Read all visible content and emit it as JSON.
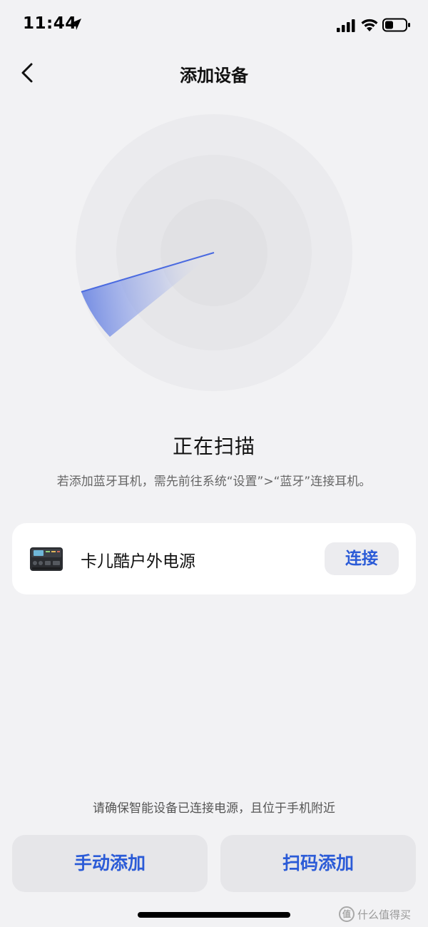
{
  "status_bar": {
    "time": "11:44",
    "icons": [
      "location-arrow-icon",
      "cellular-signal-icon",
      "wifi-icon",
      "battery-icon"
    ]
  },
  "nav": {
    "back_icon": "chevron-left-icon",
    "title": "添加设备"
  },
  "scan": {
    "status": "正在扫描",
    "hint": "若添加蓝牙耳机，需先前往系统“设置”>“蓝牙”连接耳机。"
  },
  "devices": [
    {
      "name": "卡儿酷户外电源",
      "icon": "power-station-image",
      "action": "连接"
    }
  ],
  "footer": {
    "hint": "请确保智能设备已连接电源，且位于手机附近",
    "manual_add": "手动添加",
    "scan_add": "扫码添加"
  },
  "watermark": {
    "logo_text": "值",
    "text": "什么值得买"
  },
  "colors": {
    "accent": "#2b5bd7",
    "background": "#f2f2f4",
    "card": "#ffffff",
    "button_bg": "#e6e6e9"
  }
}
